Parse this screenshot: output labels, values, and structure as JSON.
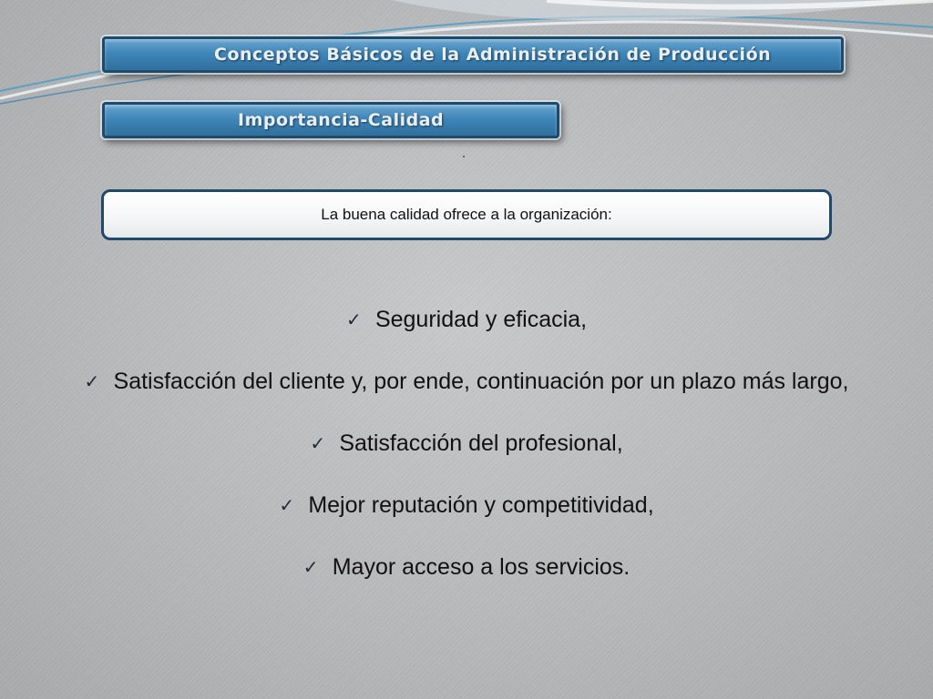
{
  "slide": {
    "main_title": "Conceptos Básicos de la Administración de Producción",
    "subtitle": "Importancia-Calidad",
    "intro": "La buena calidad ofrece a la organización:",
    "check_icon": "checkmark-icon",
    "items": [
      "Seguridad y eficacia,",
      "Satisfacción del cliente y, por ende, continuación por un plazo más largo,",
      "Satisfacción del profesional,",
      "Mejor reputación y competitividad,",
      "Mayor acceso a los servicios."
    ]
  },
  "colors": {
    "banner_fill": "#3f86b8",
    "banner_border": "#1f4a6a",
    "background": "#b8b9bb",
    "text": "#111111",
    "decor_stroke": "#4a9fc8"
  }
}
